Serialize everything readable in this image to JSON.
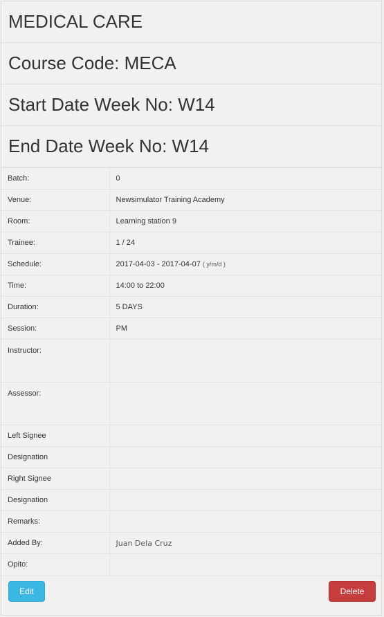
{
  "header": {
    "course_name": "MEDICAL CARE",
    "course_code": "Course Code: MECA",
    "start_week": "Start Date Week No: W14",
    "end_week": "End Date Week No: W14"
  },
  "details": {
    "batch": {
      "label": "Batch:",
      "value": "0"
    },
    "venue": {
      "label": "Venue:",
      "value": "Newsimulator Training Academy"
    },
    "room": {
      "label": "Room:",
      "value": "Learning station 9"
    },
    "trainee": {
      "label": "Trainee:",
      "value": "1 / 24"
    },
    "schedule": {
      "label": "Schedule:",
      "value": "2017-04-03 - 2017-04-07",
      "format": "( y/m/d )"
    },
    "time": {
      "label": "Time:",
      "value": "14:00 to 22:00"
    },
    "duration": {
      "label": "Duration:",
      "value": "5 DAYS"
    },
    "session": {
      "label": "Session:",
      "value": "PM"
    },
    "instructor": {
      "label": "Instructor:",
      "value": ""
    },
    "assessor": {
      "label": "Assessor:",
      "value": ""
    },
    "left_signee": {
      "label": "Left Signee",
      "value": ""
    },
    "left_designation": {
      "label": "Designation",
      "value": ""
    },
    "right_signee": {
      "label": "Right Signee",
      "value": ""
    },
    "right_designation": {
      "label": "Designation",
      "value": ""
    },
    "remarks": {
      "label": "Remarks:",
      "value": ""
    },
    "added_by": {
      "label": "Added By:",
      "value": "Juan Dela Cruz"
    },
    "opito": {
      "label": "Opito:",
      "value": ""
    }
  },
  "actions": {
    "edit_label": "Edit",
    "delete_label": "Delete"
  },
  "colors": {
    "edit": "#3bb7e4",
    "delete": "#c53d3d"
  }
}
